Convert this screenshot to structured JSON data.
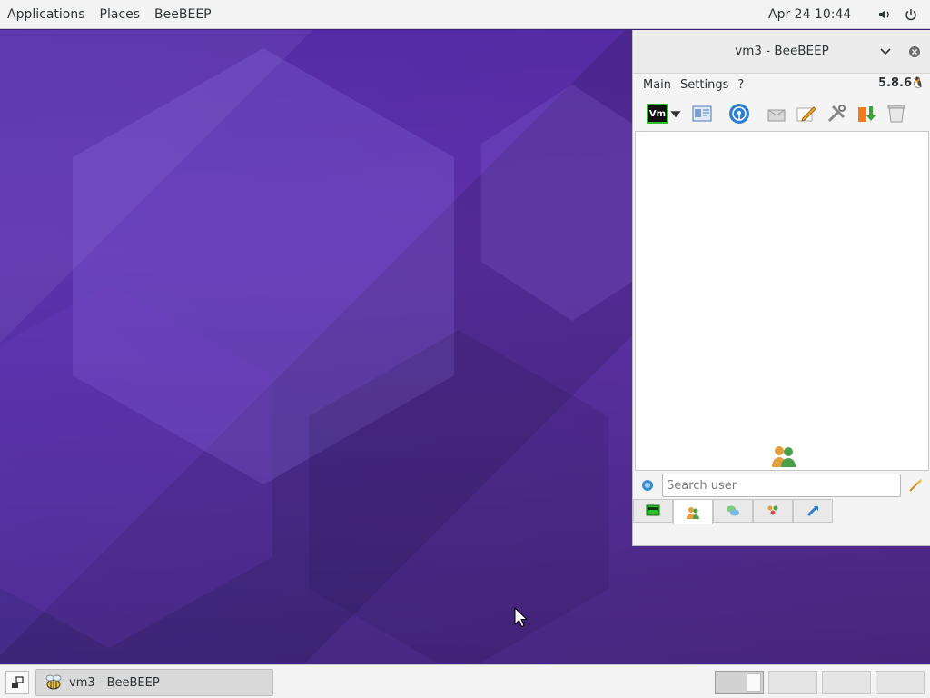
{
  "topbar": {
    "applications": "Applications",
    "places": "Places",
    "app_name": "BeeBEEP",
    "clock": "Apr 24  10:44"
  },
  "window": {
    "title": "vm3 - BeeBEEP",
    "menu": [
      "Main",
      "Settings",
      "?"
    ],
    "version": "5.8.6",
    "status_badge": "Vm",
    "search_placeholder": "Search user",
    "tabs": [
      "chat-list",
      "users",
      "chats",
      "groups",
      "share"
    ]
  },
  "taskbar": {
    "task_label": "vm3 - BeeBEEP",
    "workspaces": 4,
    "active_workspace": 1
  },
  "colors": {
    "desktop_bg": "#4b2aa3",
    "panel_bg": "#f3f3f3",
    "status_green": "#2fbf2f"
  }
}
